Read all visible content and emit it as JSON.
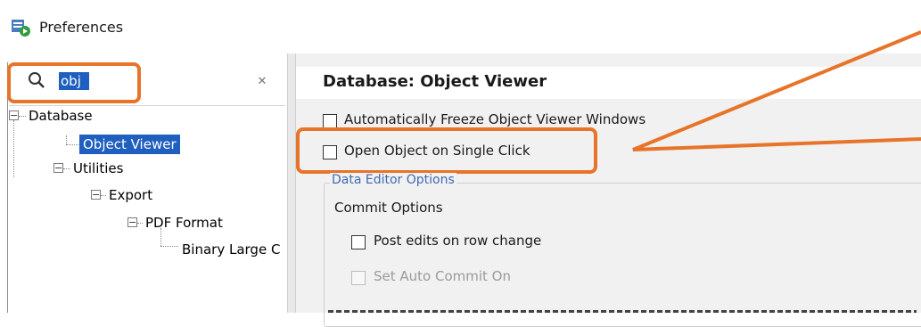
{
  "window": {
    "title": "Preferences",
    "icon": "preferences-app-icon"
  },
  "search": {
    "value": "obj",
    "clear_icon": "clear-icon"
  },
  "tree": {
    "items": [
      {
        "label": "Database",
        "expanded": true
      },
      {
        "label": "Object Viewer",
        "selected": true
      },
      {
        "label": "Utilities",
        "expanded": true
      },
      {
        "label": "Export",
        "expanded": true
      },
      {
        "label": "PDF Format",
        "expanded": true
      },
      {
        "label": "Binary Large C"
      }
    ]
  },
  "panel": {
    "heading": "Database: Object Viewer",
    "options": [
      {
        "label": "Automatically Freeze Object Viewer Windows",
        "checked": false
      },
      {
        "label": "Open Object on Single Click",
        "checked": false
      }
    ],
    "group_title": "Data Editor Options",
    "commit_title": "Commit Options",
    "commit_options": [
      {
        "label": "Post edits on row change",
        "checked": false,
        "enabled": true
      },
      {
        "label": "Set Auto Commit On",
        "checked": false,
        "enabled": false
      }
    ]
  },
  "colors": {
    "highlight": "#e8742a",
    "selection": "#1f5fbf",
    "group_title": "#3f6ab3"
  }
}
